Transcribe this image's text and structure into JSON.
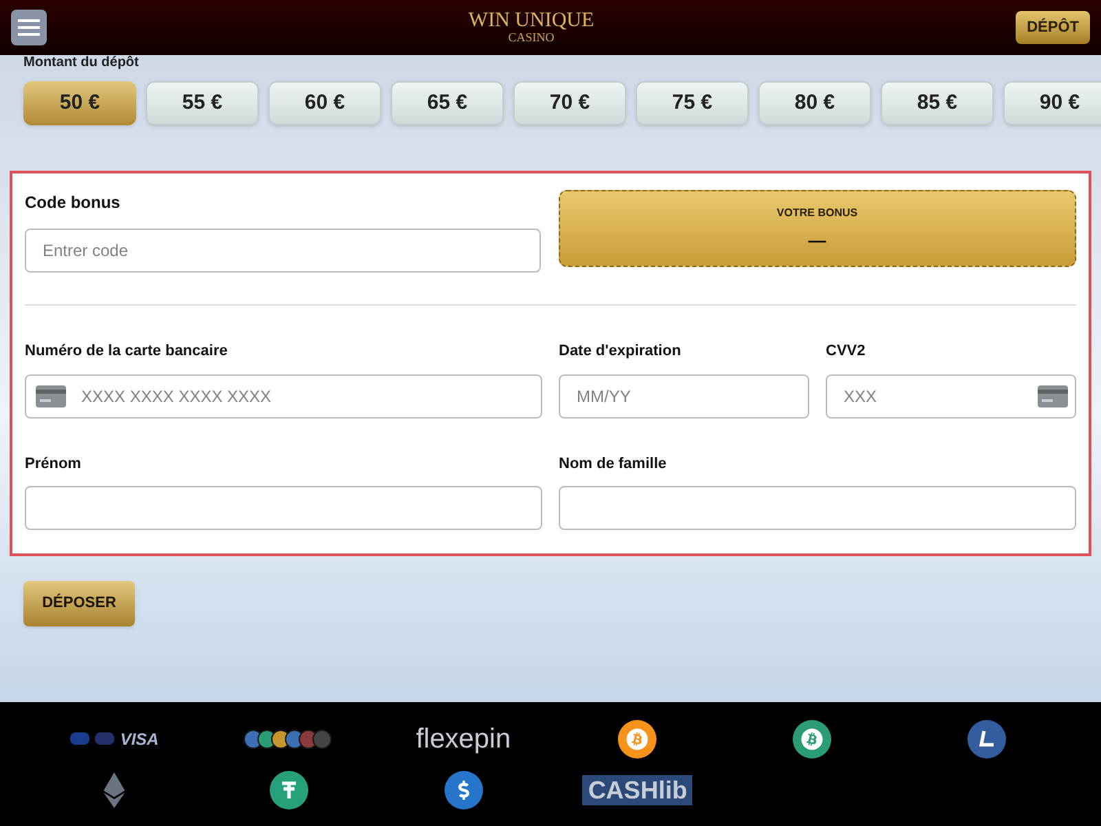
{
  "header": {
    "logo_title": "WIN UNIQUE",
    "logo_subtitle": "CASINO",
    "deposit_button": "DÉPÔT"
  },
  "amount": {
    "label": "Montant du dépôt",
    "options": [
      {
        "label": "50 €",
        "selected": true
      },
      {
        "label": "55 €",
        "selected": false
      },
      {
        "label": "60 €",
        "selected": false
      },
      {
        "label": "65 €",
        "selected": false
      },
      {
        "label": "70 €",
        "selected": false
      },
      {
        "label": "75 €",
        "selected": false
      },
      {
        "label": "80 €",
        "selected": false
      },
      {
        "label": "85 €",
        "selected": false
      },
      {
        "label": "90 €",
        "selected": false
      }
    ]
  },
  "form": {
    "bonus_label": "Code bonus",
    "bonus_placeholder": "Entrer code",
    "bonus_ticket_title": "VOTRE BONUS",
    "bonus_ticket_value": "—",
    "card_label": "Numéro de la carte bancaire",
    "card_placeholder": "XXXX XXXX XXXX XXXX",
    "expiry_label": "Date d'expiration",
    "expiry_placeholder": "MM/YY",
    "cvv_label": "CVV2",
    "cvv_placeholder": "XXX",
    "first_name_label": "Prénom",
    "last_name_label": "Nom de famille"
  },
  "submit_button": "DÉPOSER",
  "payment_methods": [
    {
      "kind": "cards",
      "text": "VISA"
    },
    {
      "kind": "coins"
    },
    {
      "kind": "wordmark",
      "text": "flexepin"
    },
    {
      "kind": "bitcoin",
      "color": "#f7931a"
    },
    {
      "kind": "bitcoin",
      "color": "#2a9d74"
    },
    {
      "kind": "litecoin",
      "color": "#345d9d"
    },
    {
      "kind": "ethereum",
      "color": "#6b7280"
    },
    {
      "kind": "tether",
      "color": "#26a17b"
    },
    {
      "kind": "usdc",
      "color": "#2775ca"
    },
    {
      "kind": "cashlib",
      "text": "CASHlib"
    }
  ]
}
